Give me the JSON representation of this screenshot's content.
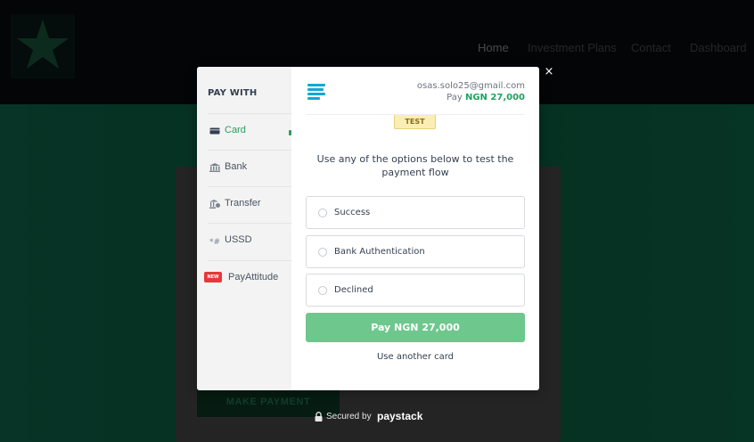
{
  "site": {
    "nav": [
      "Home",
      "Investment Plans",
      "Contact",
      "Dashboard"
    ],
    "make_payment_label": "MAKE PAYMENT"
  },
  "sidebar": {
    "title": "PAY WITH",
    "methods": [
      {
        "label": "Card",
        "icon": "card-icon",
        "active": true
      },
      {
        "label": "Bank",
        "icon": "bank-icon"
      },
      {
        "label": "Transfer",
        "icon": "transfer-icon"
      },
      {
        "label": "USSD",
        "icon": "ussd-icon"
      },
      {
        "label": "PayAttitude",
        "icon": "new-badge-icon",
        "badge": "NEW"
      }
    ]
  },
  "payment": {
    "email": "osas.solo25@gmail.com",
    "pay_prefix": "Pay",
    "amount": "NGN 27,000",
    "test_badge": "TEST",
    "instructions": "Use any of the options below to test the payment flow",
    "options": [
      "Success",
      "Bank Authentication",
      "Declined"
    ],
    "pay_button": "Pay NGN 27,000",
    "alt_link": "Use another card"
  },
  "footer": {
    "secured_text": "Secured by",
    "brand": "paystack"
  },
  "close_icon": "×",
  "colors": {
    "accent_green": "#25a05e",
    "pay_button": "#6ec78c",
    "brand_blue": "#14a7d6",
    "header_bg": "#06090d"
  }
}
